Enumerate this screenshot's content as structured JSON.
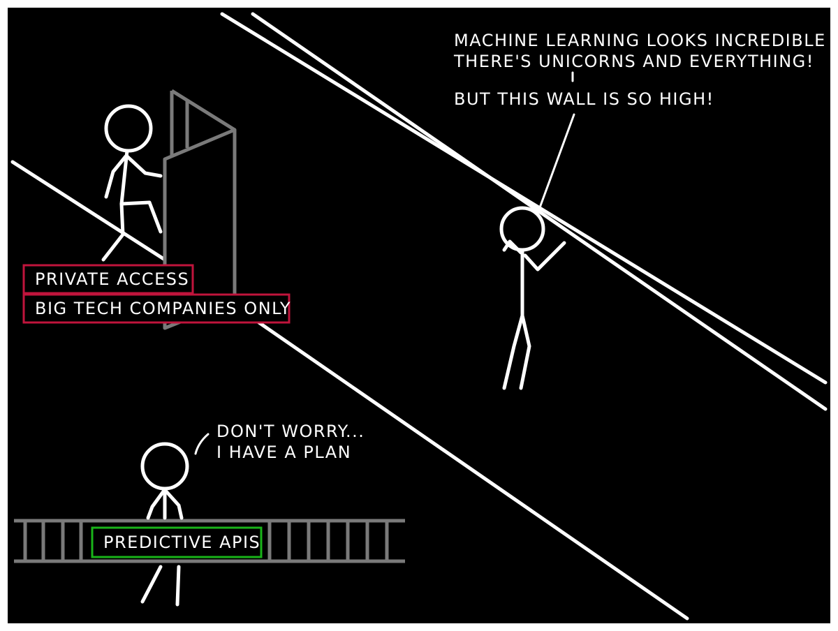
{
  "panel": {
    "background": "#000000",
    "border": "#ffffff"
  },
  "speech": {
    "wall_guy_line1": "MACHINE LEARNING LOOKS INCREDIBLE",
    "wall_guy_line2": "THERE'S UNICORNS AND EVERYTHING!",
    "wall_guy_line3": "BUT THIS WALL IS SO HIGH!",
    "plan_guy_line1": "DON'T WORRY...",
    "plan_guy_line2": "I HAVE A PLAN"
  },
  "signs": {
    "private_access": "PRIVATE ACCESS",
    "big_tech_only": "BIG TECH COMPANIES ONLY",
    "predictive_apis": "PREDICTIVE APIS",
    "private_color": "#c0143c",
    "api_color": "#19b419"
  },
  "colors": {
    "ink": "#ffffff",
    "grey_structures": "#7a7a7a"
  }
}
